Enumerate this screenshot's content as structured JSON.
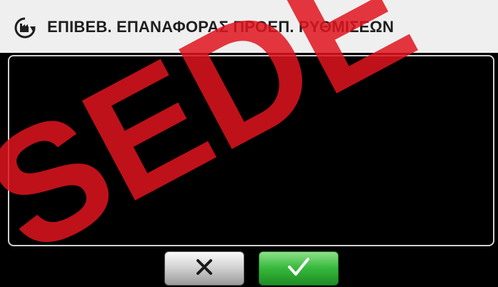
{
  "dialog": {
    "title": "ΕΠΙΒΕΒ. ΕΠΑΝΑΦΟΡΑΣ ΠΡΟΕΠ. ΡΥΘΜΙΣΕΩΝ",
    "icon": "factory-reset-icon"
  },
  "buttons": {
    "cancel_icon": "close-icon",
    "confirm_icon": "checkmark-icon"
  },
  "watermark": {
    "text": "SEDE"
  },
  "colors": {
    "header_bg": "#efefef",
    "content_bg": "#000000",
    "cancel_bg": "#d4d4d4",
    "confirm_bg": "#35b83a",
    "watermark": "#e0141e"
  }
}
